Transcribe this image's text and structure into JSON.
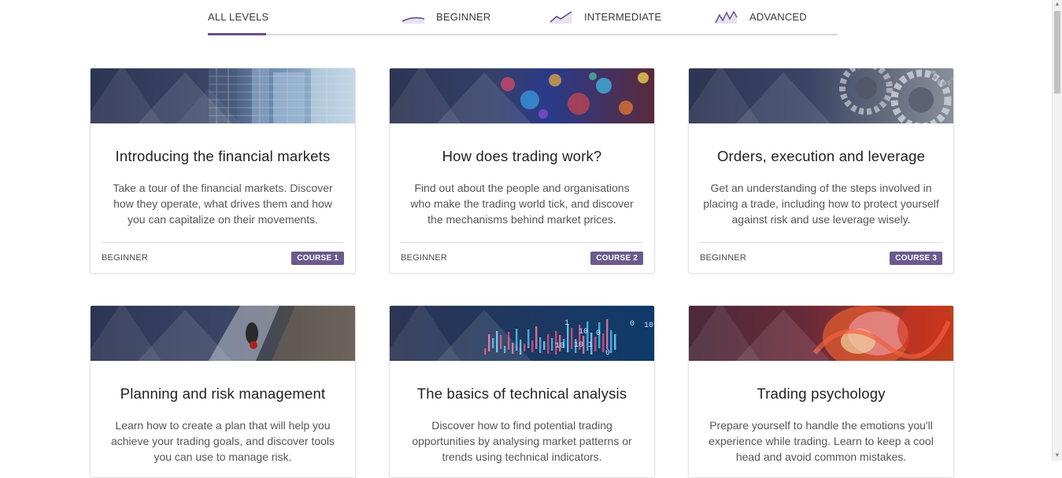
{
  "tabs": [
    {
      "label": "ALL LEVELS",
      "icon": "",
      "active": true
    },
    {
      "label": "BEGINNER",
      "icon": "beginner-chart-icon",
      "active": false
    },
    {
      "label": "INTERMEDIATE",
      "icon": "intermediate-chart-icon",
      "active": false
    },
    {
      "label": "ADVANCED",
      "icon": "advanced-chart-icon",
      "active": false
    }
  ],
  "colors": {
    "accent": "#6b4e8e",
    "badge": "#6b5a8e",
    "banner_overlay": "#2c3553"
  },
  "cards": [
    {
      "title": "Introducing the financial markets",
      "description": "Take a tour of the financial markets. Discover how they operate, what drives them and how you can capitalize on their movements.",
      "level": "BEGINNER",
      "badge": "COURSE 1",
      "image": "skyscrapers-banner"
    },
    {
      "title": "How does trading work?",
      "description": "Find out about the people and organisations who make the trading world tick, and discover the mechanisms behind market prices.",
      "level": "BEGINNER",
      "badge": "COURSE 2",
      "image": "city-lights-banner"
    },
    {
      "title": "Orders, execution and leverage",
      "description": "Get an understanding of the steps involved in placing a trade, including how to protect yourself against risk and use leverage wisely.",
      "level": "BEGINNER",
      "badge": "COURSE 3",
      "image": "gears-banner"
    },
    {
      "title": "Planning and risk management",
      "description": "Learn how to create a plan that will help you achieve your trading goals, and discover tools you can use to manage risk.",
      "image": "climber-banner"
    },
    {
      "title": "The basics of technical analysis",
      "description": "Discover how to find potential trading opportunities by analysing market patterns or trends using technical indicators.",
      "image": "data-chart-banner"
    },
    {
      "title": "Trading psychology",
      "description": "Prepare yourself to handle the emotions you'll experience while trading. Learn to keep a cool head and avoid common mistakes.",
      "image": "abstract-face-banner"
    }
  ],
  "banner_digits": [
    "0",
    "10",
    "10",
    "10",
    "0",
    "10 1",
    "0",
    "1"
  ],
  "scrollbar": {
    "up": "▲",
    "down": "▼"
  }
}
